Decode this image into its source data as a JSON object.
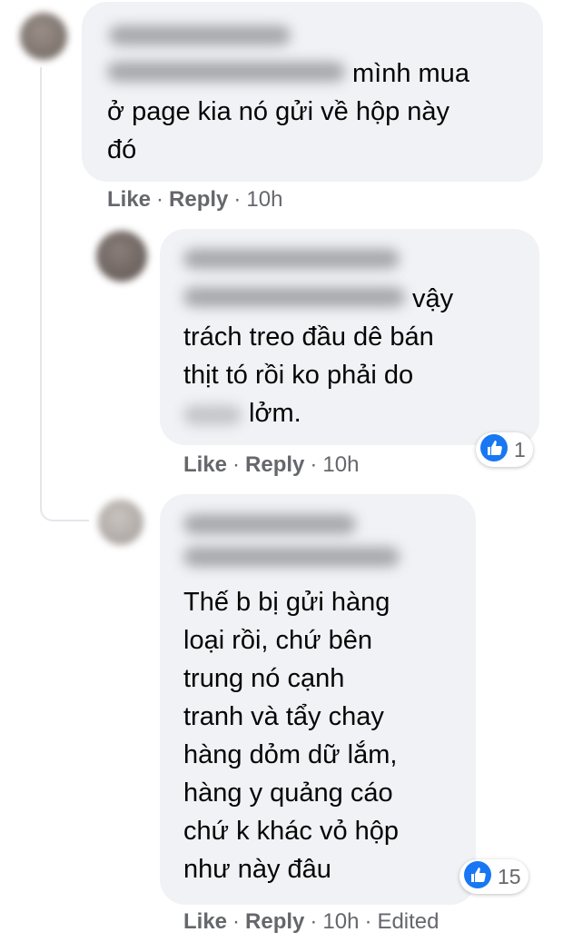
{
  "comments": [
    {
      "text_line1_suffix": "mình mua",
      "text_lines": [
        "ở page kia nó gửi về hộp này",
        "đó"
      ],
      "actions": {
        "like": "Like",
        "reply": "Reply",
        "time": "10h"
      }
    },
    {
      "text_line1_suffix": "vậy",
      "text_lines": [
        "trách treo đầu dê bán",
        "thịt tó rồi ko phải do"
      ],
      "text_last_suffix": "lởm.",
      "actions": {
        "like": "Like",
        "reply": "Reply",
        "time": "10h"
      },
      "reaction": {
        "icon": "like-icon",
        "count": "1",
        "color": "#1877f2"
      }
    },
    {
      "text_lines": [
        "Thế b bị gửi hàng",
        "loại rồi, chứ bên",
        "trung nó cạnh",
        "tranh và tẩy chay",
        "hàng dỏm dữ lắm,",
        "hàng y quảng cáo",
        "chứ k khác vỏ hộp",
        "như này đâu"
      ],
      "actions": {
        "like": "Like",
        "reply": "Reply",
        "time": "10h",
        "edited": "Edited"
      },
      "reaction": {
        "icon": "like-icon",
        "count": "15",
        "color": "#1877f2"
      }
    }
  ]
}
